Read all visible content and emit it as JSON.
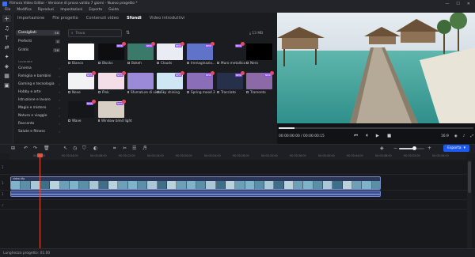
{
  "window": {
    "title": "Filmora Video Editor - Versione di prova valida 7 giorni - Nuovo progetto *",
    "controls": [
      "—",
      "☐",
      "✕"
    ]
  },
  "menu": [
    "File",
    "Modifica",
    "Riproduci",
    "Impostazioni",
    "Esporta",
    "Guida"
  ],
  "tabs": [
    {
      "label": "Importazione",
      "active": false
    },
    {
      "label": "File progetto",
      "active": false
    },
    {
      "label": "Contenuti video",
      "active": false
    },
    {
      "label": "Sfondi",
      "active": true
    },
    {
      "label": "Video introduttivi",
      "active": false
    }
  ],
  "categories": {
    "top": [
      {
        "label": "Consigliati",
        "count": "58",
        "selected": true
      },
      {
        "label": "Preferiti",
        "count": "0",
        "selected": false
      },
      {
        "label": "Gratis",
        "count": "26",
        "selected": false
      }
    ],
    "section_label": "Lavoratie",
    "list": [
      "Cinema",
      "Famiglia e bambini",
      "Gaming e tecnologia",
      "Hobby e arte",
      "Istruzione e lavoro",
      "Magia e mistero",
      "Natura e viaggio",
      "Racconto",
      "Salute e fitness"
    ]
  },
  "search": {
    "placeholder": "Trova"
  },
  "storage": "13 MB",
  "grid": {
    "items": [
      {
        "label": "Bianco",
        "color": "#ffffff",
        "badge": false
      },
      {
        "label": "Blocks",
        "color": "#0e0e10",
        "badge": true
      },
      {
        "label": "Bokeh",
        "color": "#3a7a6a",
        "badge": true
      },
      {
        "label": "Clouds",
        "color": "#e9ecf2",
        "badge": true
      },
      {
        "label": "Immaginazio...",
        "color": "#5f74c8",
        "badge": true
      },
      {
        "label": "Muro metallico",
        "color": "#1b1c22",
        "badge": true
      },
      {
        "label": "Nero",
        "color": "#000000",
        "badge": false
      },
      {
        "label": "Neve",
        "color": "#f2f2f4",
        "badge": true
      },
      {
        "label": "Pink",
        "color": "#f3dde6",
        "badge": true
      },
      {
        "label": "Sfumature di viola",
        "color": "#9a8ad8",
        "badge": false
      },
      {
        "label": "Sky shining",
        "color": "#cfe6f4",
        "badge": true
      },
      {
        "label": "Spring mood 3",
        "color": "#8a6fb8",
        "badge": true
      },
      {
        "label": "Tracciato",
        "color": "#26304a",
        "badge": true
      },
      {
        "label": "Tramonto",
        "color": "#8c6aa8",
        "badge": true
      },
      {
        "label": "Wave",
        "color": "#15161a",
        "badge": true
      },
      {
        "label": "Window blind light",
        "color": "#d8cfc4",
        "badge": true
      }
    ],
    "badge_text": "NEW"
  },
  "preview": {
    "time": "00:00:00:00 / 00:00:00:15",
    "progress": 0.08,
    "quality": "16:9",
    "volume_icon": "volume-icon"
  },
  "toolbar": {
    "export_label": "Esporta"
  },
  "zoom": {
    "level": 0.6
  },
  "ruler": {
    "ticks": [
      "00:00:00",
      "00:00:04:00",
      "00:00:08:00",
      "00:00:12:00",
      "00:00:16:00",
      "00:00:20:00",
      "00:00:24:00",
      "00:00:28:00",
      "00:00:32:00",
      "00:00:36:00",
      "00:00:40:00",
      "00:00:44:00",
      "00:00:48:00",
      "00:00:52:00",
      "00:00:56:00",
      "00:01:00:00"
    ]
  },
  "timeline": {
    "clip_label": "video clip",
    "track_labels": [
      "1",
      "1",
      "1"
    ]
  },
  "status": {
    "text": "Lunghezza progetto: 01:00"
  },
  "colors": {
    "accent": "#1d5bf0",
    "playhead": "#e0533d",
    "badge": "#8d4df2",
    "clip": "#2c3658"
  }
}
